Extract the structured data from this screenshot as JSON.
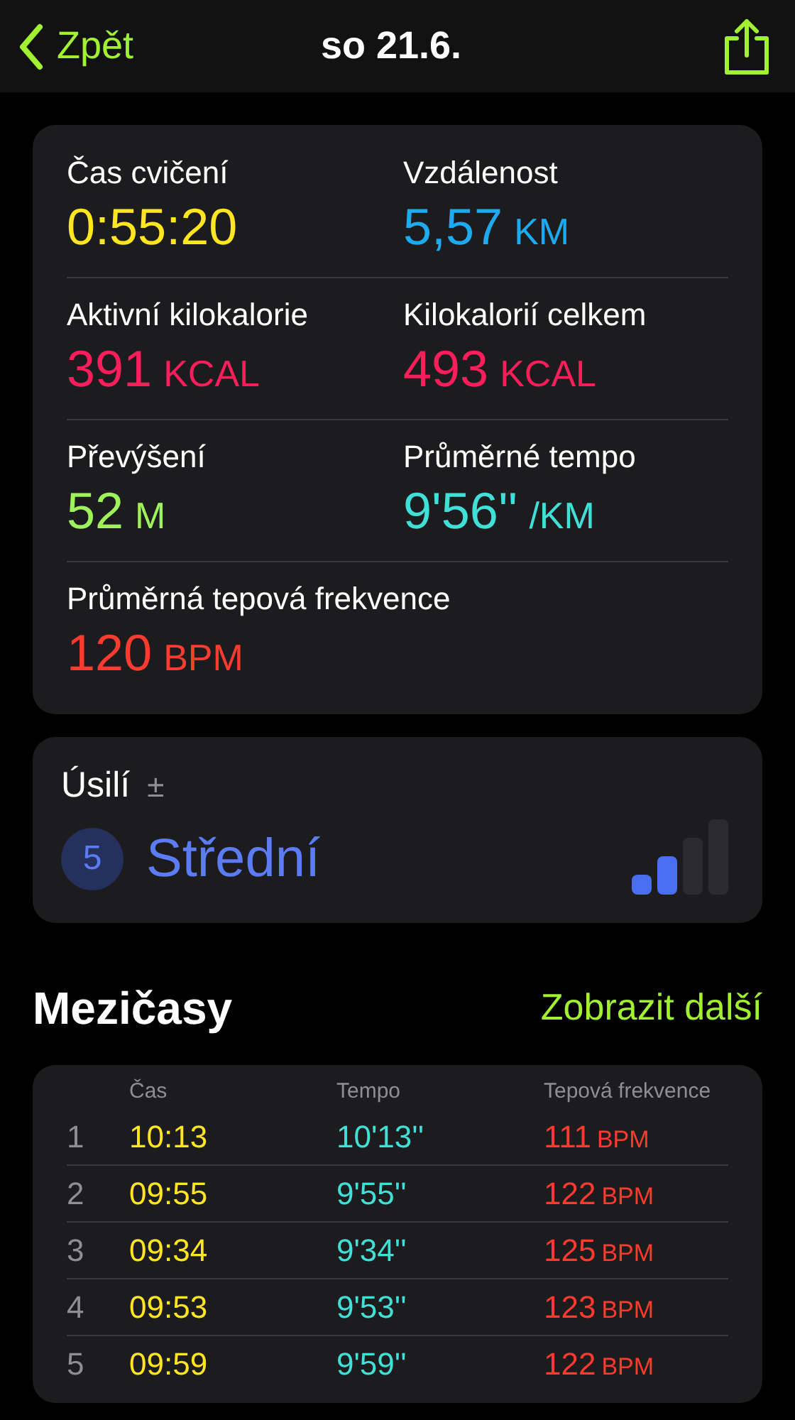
{
  "nav": {
    "back": "Zpět",
    "title": "so 21.6."
  },
  "metrics": [
    {
      "label": "Čas cvičení",
      "value": "0:55:20",
      "color": "#ffe620"
    },
    {
      "label": "Vzdálenost",
      "value": "5,57",
      "unit": "KM",
      "color": "#1eaaf1"
    },
    {
      "label": "Aktivní kilokalorie",
      "value": "391",
      "unit": "KCAL",
      "color": "#fa1e5a"
    },
    {
      "label": "Kilokalorií celkem",
      "value": "493",
      "unit": "KCAL",
      "color": "#fa1e5a"
    },
    {
      "label": "Převýšení",
      "value": "52",
      "unit": "M",
      "color": "#9ef25a"
    },
    {
      "label": "Průměrné tempo",
      "value": "9'56''",
      "unit": "/KM",
      "color": "#40e0d8"
    },
    {
      "label": "Průměrná tepová frekvence",
      "value": "120",
      "unit": "BPM",
      "color": "#ff3b2f"
    }
  ],
  "effort": {
    "title": "Úsilí",
    "adjust": "±",
    "score": "5",
    "label": "Střední",
    "level": 0.5
  },
  "splits": {
    "title": "Mezičasy",
    "more": "Zobrazit další",
    "columns": [
      "Čas",
      "Tempo",
      "Tepová frekvence"
    ],
    "rows": [
      {
        "index": "1",
        "time": "10:13",
        "pace": "10'13''",
        "hr": "111",
        "unit": "BPM"
      },
      {
        "index": "2",
        "time": "09:55",
        "pace": "9'55''",
        "hr": "122",
        "unit": "BPM"
      },
      {
        "index": "3",
        "time": "09:34",
        "pace": "9'34''",
        "hr": "125",
        "unit": "BPM"
      },
      {
        "index": "4",
        "time": "09:53",
        "pace": "9'53''",
        "hr": "123",
        "unit": "BPM"
      },
      {
        "index": "5",
        "time": "09:59",
        "pace": "9'59''",
        "hr": "122",
        "unit": "BPM"
      }
    ]
  }
}
